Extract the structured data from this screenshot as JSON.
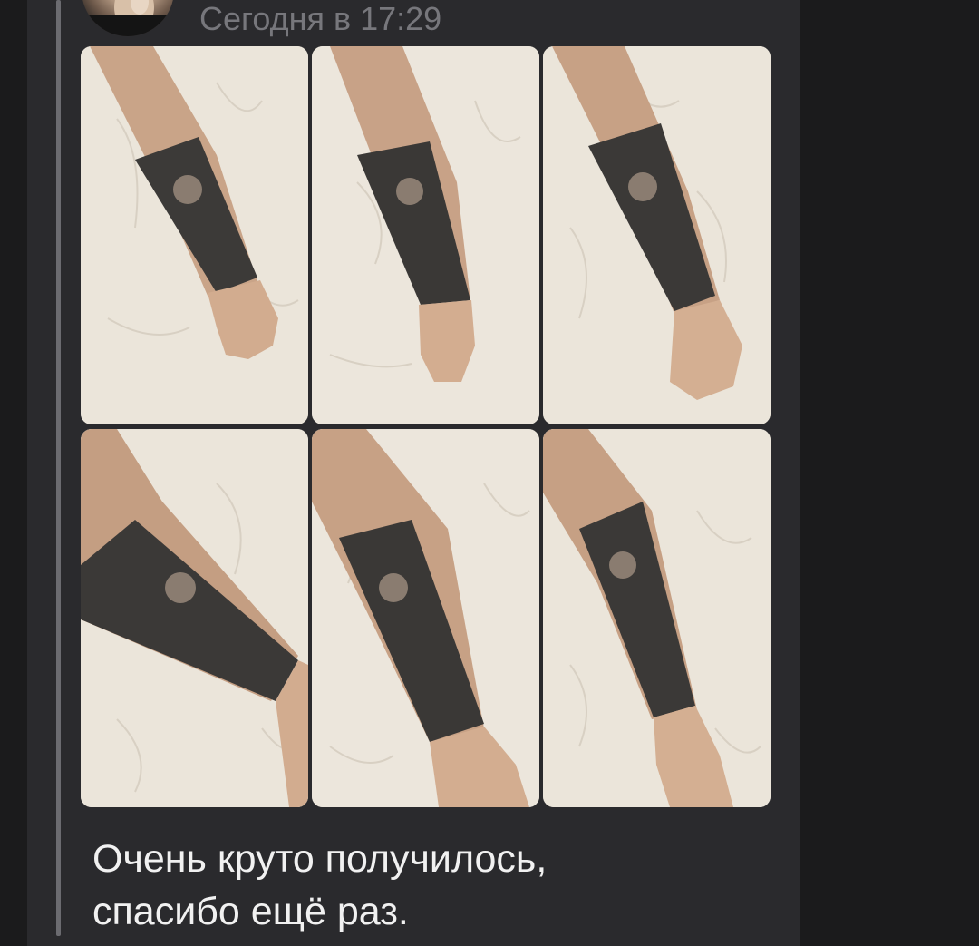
{
  "message": {
    "timestamp": "Сегодня в 17:29",
    "caption_lines": [
      "Очень круто получилось,",
      "спасибо ещё раз."
    ],
    "photo_count": 6
  },
  "colors": {
    "app_background": "#1b1b1c",
    "message_background": "#2a2a2d",
    "quote_bar": "#6b6b70",
    "timestamp_text": "#77777c",
    "caption_text": "#f1f1f1"
  }
}
